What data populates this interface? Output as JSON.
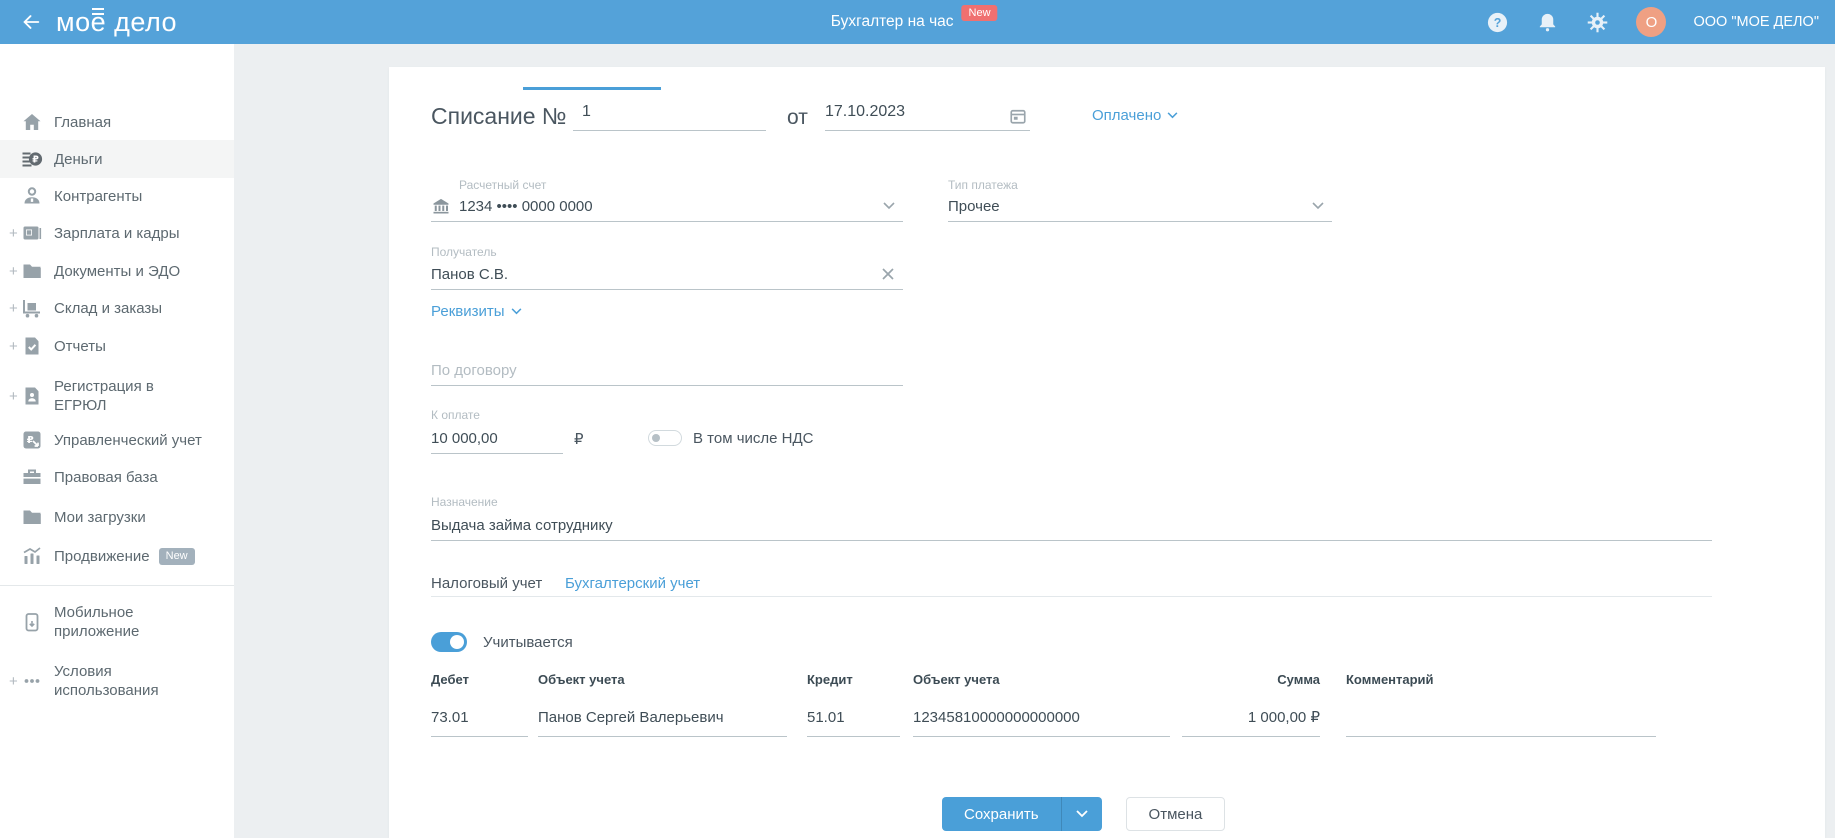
{
  "topbar": {
    "logo_mo": "мо",
    "logo_e": "е",
    "logo_rest": " дело",
    "center_label": "Бухгалтер на час",
    "center_badge": "New",
    "company": "ООО \"МОЕ ДЕЛО\"",
    "avatar_initial": "O"
  },
  "sidebar": {
    "plus_glyph": "+",
    "new_badge": "New",
    "items": [
      {
        "label": "Главная"
      },
      {
        "label": "Деньги"
      },
      {
        "label": "Контрагенты"
      },
      {
        "label": "Зарплата и кадры"
      },
      {
        "label": "Документы и ЭДО"
      },
      {
        "label": "Склад и заказы"
      },
      {
        "label": "Отчеты"
      },
      {
        "label": "Регистрация в\nЕГРЮЛ"
      },
      {
        "label": "Управленческий учет"
      },
      {
        "label": "Правовая база"
      },
      {
        "label": "Мои загрузки"
      },
      {
        "label": "Продвижение"
      },
      {
        "label": "Мобильное\nприложение"
      },
      {
        "label": "Условия\nиспользования"
      }
    ]
  },
  "form": {
    "title": "Списание №",
    "number": "1",
    "date_label": "от",
    "date": "17.10.2023",
    "status": "Оплачено",
    "account_label": "Расчетный счет",
    "account_value": "1234 •••• 0000 0000",
    "payment_type_label": "Тип платежа",
    "payment_type_value": "Прочее",
    "recipient_label": "Получатель",
    "recipient_value": "Панов С.В.",
    "requisites_link": "Реквизиты",
    "contract_placeholder": "По договору",
    "amount_label": "К оплате",
    "amount_value": "10 000,00",
    "currency": "₽",
    "vat_label": "В том числе НДС",
    "purpose_label": "Назначение",
    "purpose_value": "Выдача займа сотруднику",
    "tab_tax": "Налоговый учет",
    "tab_accounting": "Бухгалтерский учет",
    "accounted_label": "Учитывается",
    "table": {
      "headers": [
        "Дебет",
        "Объект учета",
        "Кредит",
        "Объект учета",
        "Сумма",
        "Комментарий"
      ],
      "row": {
        "debit": "73.01",
        "debit_object": "Панов Сергей Валерьевич",
        "credit": "51.01",
        "credit_object": "12345810000000000000",
        "amount": "1 000,00 ₽",
        "comment": ""
      }
    },
    "save_button": "Сохранить",
    "cancel_button": "Отмена"
  },
  "colors": {
    "topbar_blue": "#54a2d9",
    "accent_blue": "#4a9fd8",
    "badge_red": "#f07070",
    "badge_gray": "#a3b1bc",
    "avatar_salmon": "#efa083"
  }
}
